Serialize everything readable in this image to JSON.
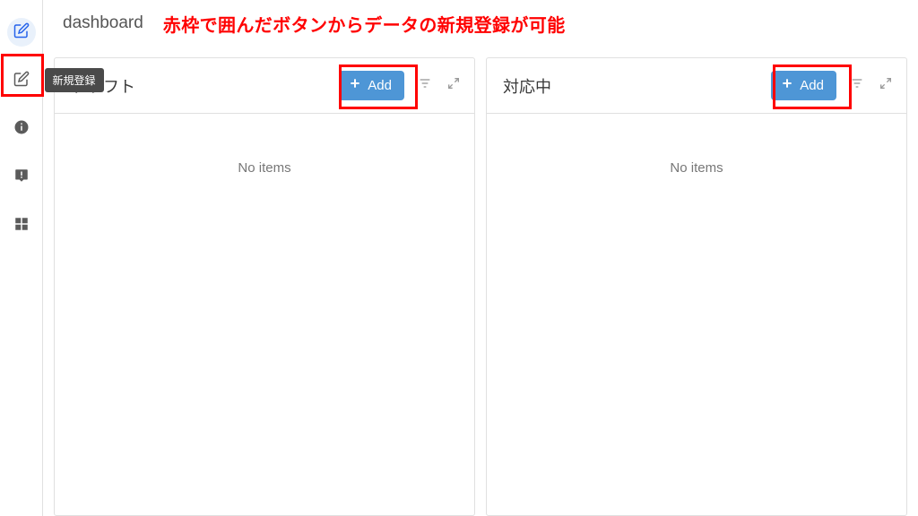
{
  "header": {
    "title": "dashboard"
  },
  "annotation": {
    "caption": "赤枠で囲んだボタンからデータの新規登録が可能"
  },
  "sidebar": {
    "tooltip": "新規登録",
    "items": [
      {
        "name": "compose"
      },
      {
        "name": "compose-secondary"
      },
      {
        "name": "info"
      },
      {
        "name": "alert"
      },
      {
        "name": "grid"
      }
    ]
  },
  "panels": [
    {
      "title": "ドラフト",
      "add_label": "Add",
      "empty": "No items"
    },
    {
      "title": "対応中",
      "add_label": "Add",
      "empty": "No items"
    }
  ]
}
